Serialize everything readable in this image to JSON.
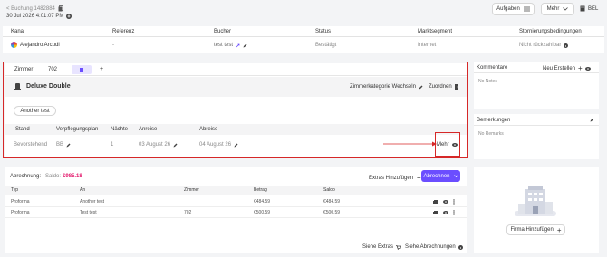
{
  "header": {
    "breadcrumb": "< Buchung 1482884",
    "datetime": "30 Jul 2026 4:01:07 PM",
    "buttons": {
      "aufgaben": "Aufgaben",
      "mehr": "Mehr",
      "lang": "BEL"
    }
  },
  "booking_table": {
    "columns": [
      "Kanal",
      "Referenz",
      "Bucher",
      "Status",
      "Marktsegment",
      "Stornierungsbedingungen"
    ],
    "row": {
      "kanal": "Alejandro Arcudi",
      "referenz": "-",
      "bucher": "test test",
      "status": "Bestätigt",
      "marktsegment": "Internet",
      "storno": "Nicht rückzahlbar"
    }
  },
  "rooms": {
    "tabs": {
      "zimmer": "Zimmer",
      "number": "702",
      "add": "+"
    },
    "room_name": "Deluxe Double",
    "change_category": "Zimmerkategorie Wechseln",
    "assign": "Zuordnen",
    "guest_button": "Another test",
    "columns": [
      "Stand",
      "Verpflegungsplan",
      "Nächte",
      "Anreise",
      "Abreise"
    ],
    "row": {
      "stand": "Bevorstehend",
      "plan": "BB",
      "naechte": "1",
      "anreise": "03 August 26",
      "abreise": "04 August 26",
      "mehr": "Mehr"
    }
  },
  "sidebar": {
    "kommentare": {
      "title": "Kommentare",
      "action": "Neu Erstellen",
      "empty": "No Notes"
    },
    "bemerkungen": {
      "title": "Bemerkungen",
      "empty": "No Remarks"
    },
    "firma": {
      "button": "Firma Hinzufügen"
    }
  },
  "billing": {
    "title": "Abrechnung:",
    "saldo_label": "Saldo:",
    "saldo_value": "€985.18",
    "extras_button": "Extras Hinzufügen",
    "abrechnen_button": "Abrechnen",
    "columns": [
      "Typ",
      "An",
      "Zimmer",
      "Betrag",
      "Saldo"
    ],
    "rows": [
      {
        "typ": "Proforma",
        "an": "Another test",
        "zimmer": "",
        "betrag": "€484.59",
        "saldo": "€484.59"
      },
      {
        "typ": "Proforma",
        "an": "Test test",
        "zimmer": "702",
        "betrag": "€500.59",
        "saldo": "€500.59"
      }
    ],
    "footer_extras": "Siehe Extras",
    "footer_abrechnungen": "Siehe Abrechnungen"
  },
  "colors": {
    "accent": "#6b4eff",
    "saldo": "#e3176b",
    "highlight": "#d62828"
  }
}
